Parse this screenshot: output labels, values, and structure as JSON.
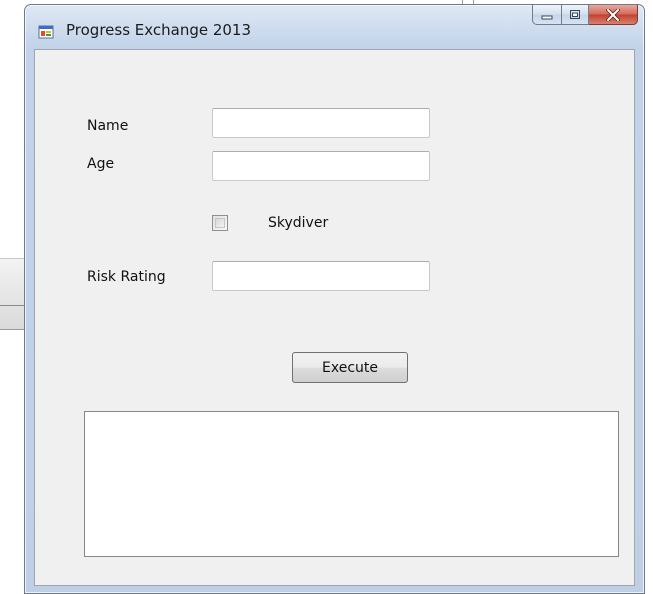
{
  "window": {
    "title": "Progress Exchange 2013",
    "icon": "winforms-app-icon"
  },
  "caption_buttons": {
    "minimize": "minimize-icon",
    "maximize": "maximize-icon",
    "close": "close-icon"
  },
  "form": {
    "name_label": "Name",
    "name_value": "",
    "age_label": "Age",
    "age_value": "",
    "skydiver_label": "Skydiver",
    "skydiver_checked": false,
    "risk_label": "Risk Rating",
    "risk_value": "",
    "execute_label": "Execute",
    "output_value": ""
  },
  "colors": {
    "client_background": "#f0f0f0",
    "close_button": "#c7493a",
    "frame": "#c2d3e8"
  }
}
